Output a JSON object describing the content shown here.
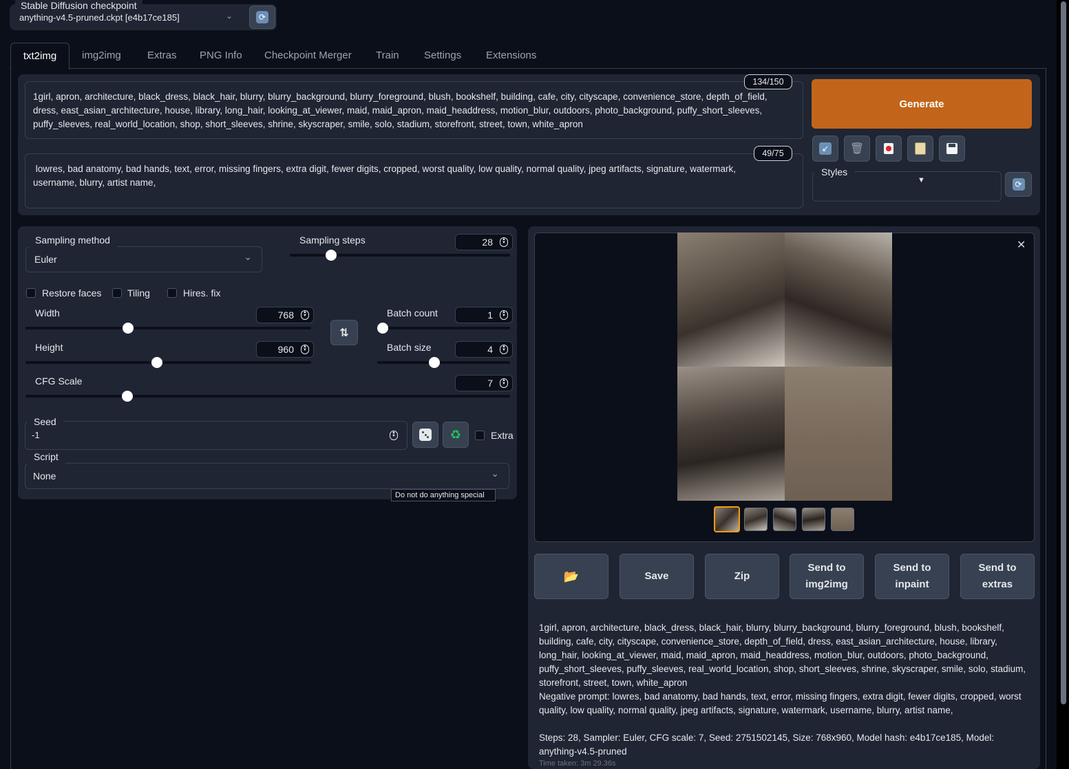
{
  "checkpoint": {
    "label": "Stable Diffusion checkpoint",
    "value": "anything-v4.5-pruned.ckpt [e4b17ce185]"
  },
  "tabs": [
    "txt2img",
    "img2img",
    "Extras",
    "PNG Info",
    "Checkpoint Merger",
    "Train",
    "Settings",
    "Extensions"
  ],
  "active_tab": "txt2img",
  "prompt": {
    "token_count": "134/150",
    "text": "1girl, apron, architecture, black_dress, black_hair, blurry, blurry_background, blurry_foreground, blush, bookshelf, building, cafe, city, cityscape, convenience_store, depth_of_field, dress, east_asian_architecture, house, library, long_hair, looking_at_viewer, maid, maid_apron, maid_headdress, motion_blur, outdoors, photo_background, puffy_short_sleeves, puffy_sleeves, real_world_location, shop, short_sleeves, shrine, skyscraper, smile, solo, stadium, storefront, street, town, white_apron"
  },
  "negative_prompt": {
    "token_count": "49/75",
    "text": " lowres, bad anatomy, bad hands, text, error, missing fingers, extra digit, fewer digits, cropped, worst quality, low quality, normal quality, jpeg artifacts, signature, watermark, username, blurry, artist name,"
  },
  "generate_label": "Generate",
  "styles_label": "Styles",
  "sampling": {
    "method_label": "Sampling method",
    "method_value": "Euler",
    "steps_label": "Sampling steps",
    "steps_value": "28",
    "steps_fraction": 0.187
  },
  "checkboxes": {
    "restore_faces": "Restore faces",
    "tiling": "Tiling",
    "hires_fix": "Hires. fix",
    "extra": "Extra"
  },
  "width": {
    "label": "Width",
    "value": "768",
    "fraction": 0.36
  },
  "height": {
    "label": "Height",
    "value": "960",
    "fraction": 0.46
  },
  "batch_count": {
    "label": "Batch count",
    "value": "1",
    "fraction": 0.0
  },
  "batch_size": {
    "label": "Batch size",
    "value": "4",
    "fraction": 0.43
  },
  "cfg": {
    "label": "CFG Scale",
    "value": "7",
    "fraction": 0.21
  },
  "seed": {
    "label": "Seed",
    "value": "-1"
  },
  "script": {
    "label": "Script",
    "value": "None",
    "tooltip": "Do not do anything special"
  },
  "output_buttons": {
    "folder": "📂",
    "save": "Save",
    "zip": "Zip",
    "send_img2img": "Send to img2img",
    "send_inpaint": "Send to inpaint",
    "send_extras": "Send to extras"
  },
  "info": {
    "prompt_line": "1girl, apron, architecture, black_dress, black_hair, blurry, blurry_background, blurry_foreground, blush, bookshelf, building, cafe, city, cityscape, convenience_store, depth_of_field, dress, east_asian_architecture, house, library, long_hair, looking_at_viewer, maid, maid_apron, maid_headdress, motion_blur, outdoors, photo_background, puffy_short_sleeves, puffy_sleeves, real_world_location, shop, short_sleeves, shrine, skyscraper, smile, solo, stadium, storefront, street, town, white_apron",
    "negative_line": "Negative prompt: lowres, bad anatomy, bad hands, text, error, missing fingers, extra digit, fewer digits, cropped, worst quality, low quality, normal quality, jpeg artifacts, signature, watermark, username, blurry, artist name,",
    "params_line": "Steps: 28, Sampler: Euler, CFG scale: 7, Seed: 2751502145, Size: 768x960, Model hash: e4b17ce185, Model: anything-v4.5-pruned",
    "time_line": "Time taken: 3m 29.36s"
  },
  "colors": {
    "accent": "#c2651a",
    "background": "#0b0f19",
    "panel": "#1f2533"
  }
}
